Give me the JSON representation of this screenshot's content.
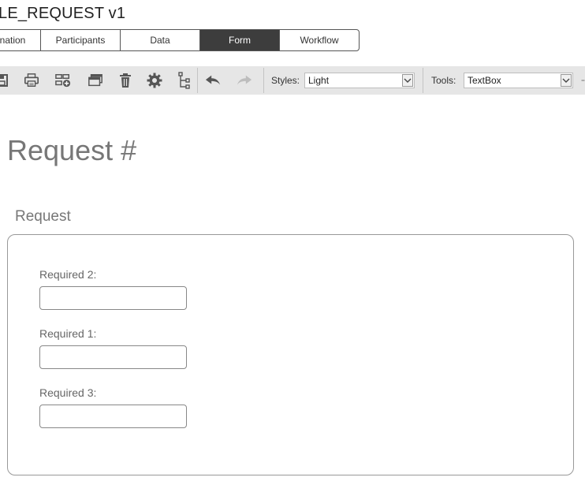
{
  "app": {
    "title": "LE_REQUEST v1"
  },
  "tabs": [
    {
      "label": "nation"
    },
    {
      "label": "Participants"
    },
    {
      "label": "Data"
    },
    {
      "label": "Form"
    },
    {
      "label": "Workflow"
    }
  ],
  "active_tab": "Form",
  "toolbar": {
    "icons": [
      "save-icon",
      "print-icon",
      "add-section-icon",
      "window-icon",
      "trash-icon",
      "settings-icon",
      "tree-icon",
      "undo-icon",
      "redo-icon"
    ],
    "styles_label": "Styles:",
    "styles_value": "Light",
    "tools_label": "Tools:",
    "tools_value": "TextBox"
  },
  "form": {
    "title": "Request #",
    "section_title": "Request",
    "fields": [
      {
        "label": "Required 2:",
        "value": ""
      },
      {
        "label": "Required 1:",
        "value": ""
      },
      {
        "label": "Required 3:",
        "value": ""
      }
    ]
  },
  "colors": {
    "toolbar_bg": "#e6e6e6",
    "active_tab_bg": "#3d3d3d",
    "icon": "#555555"
  }
}
